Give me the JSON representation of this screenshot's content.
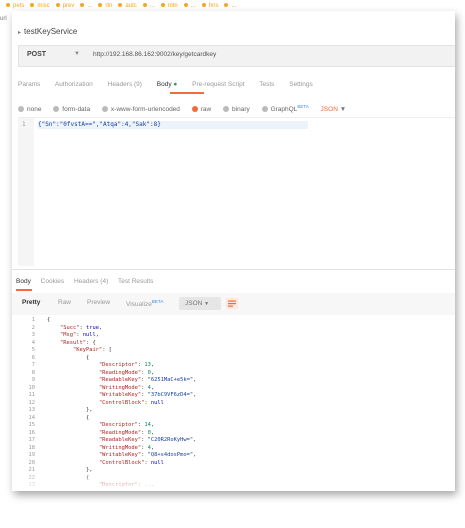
{
  "top_tabs": [
    "pets",
    "misc",
    "prev",
    "...",
    "rtn",
    "autc",
    "...",
    "mtn",
    "...",
    "hns",
    "..."
  ],
  "left_cut_text": "url",
  "request": {
    "name": "testKeyService",
    "method": "POST",
    "url": "http://192.168.86.162:9002/key/getcardkey"
  },
  "request_tabs": {
    "params": "Params",
    "authorization": "Authorization",
    "headers": "Headers (9)",
    "body": "Body",
    "prerequest": "Pre-request Script",
    "tests": "Tests",
    "settings": "Settings"
  },
  "body_types": {
    "none": "none",
    "form_data": "form-data",
    "urlencoded": "x-www-form-urlencoded",
    "raw": "raw",
    "binary": "binary",
    "graphql": "GraphQL",
    "beta": "BETA",
    "format": "JSON"
  },
  "request_body": {
    "line_number": "1",
    "text": "{\"Sn\":\"0fvstA==\",\"Atqa\":4,\"Sak\":8}"
  },
  "response_tabs": {
    "body": "Body",
    "cookies": "Cookies",
    "headers": "Headers (4)",
    "test_results": "Test Results"
  },
  "view_buttons": {
    "pretty": "Pretty",
    "raw": "Raw",
    "preview": "Preview",
    "visualize": "Visualize",
    "beta": "BETA",
    "format": "JSON"
  },
  "response_lines": [
    {
      "n": "1",
      "t": "{"
    },
    {
      "n": "2",
      "t": "    \"Succ\": true,"
    },
    {
      "n": "3",
      "t": "    \"Msg\": null,"
    },
    {
      "n": "4",
      "t": "    \"Result\": {"
    },
    {
      "n": "5",
      "t": "        \"KeyPair\": ["
    },
    {
      "n": "6",
      "t": "            {"
    },
    {
      "n": "7",
      "t": "                \"Descriptor\": 13,"
    },
    {
      "n": "8",
      "t": "                \"ReadingMode\": 0,"
    },
    {
      "n": "9",
      "t": "                \"ReadableKey\": \"6251MaC+e5k=\","
    },
    {
      "n": "10",
      "t": "                \"WritingMode\": 4,"
    },
    {
      "n": "11",
      "t": "                \"WritableKey\": \"37bC9VF6zD4=\","
    },
    {
      "n": "12",
      "t": "                \"ControlBlock\": null"
    },
    {
      "n": "13",
      "t": "            },"
    },
    {
      "n": "14",
      "t": "            {"
    },
    {
      "n": "15",
      "t": "                \"Descriptor\": 14,"
    },
    {
      "n": "16",
      "t": "                \"ReadingMode\": 0,"
    },
    {
      "n": "17",
      "t": "                \"ReadableKey\": \"C20R2RoKyHw=\","
    },
    {
      "n": "18",
      "t": "                \"WritingMode\": 4,"
    },
    {
      "n": "19",
      "t": "                \"WritableKey\": \"Q8+s4dosPmo=\","
    },
    {
      "n": "20",
      "t": "                \"ControlBlock\": null"
    },
    {
      "n": "21",
      "t": "            },"
    },
    {
      "n": "22",
      "t": "            {"
    },
    {
      "n": "23",
      "t": "                \"Descriptor\": ..."
    }
  ],
  "colors": {
    "accent": "#f26b3a",
    "green": "#2e9d57",
    "key": "#b11e1e",
    "string": "#1a3fa0"
  }
}
